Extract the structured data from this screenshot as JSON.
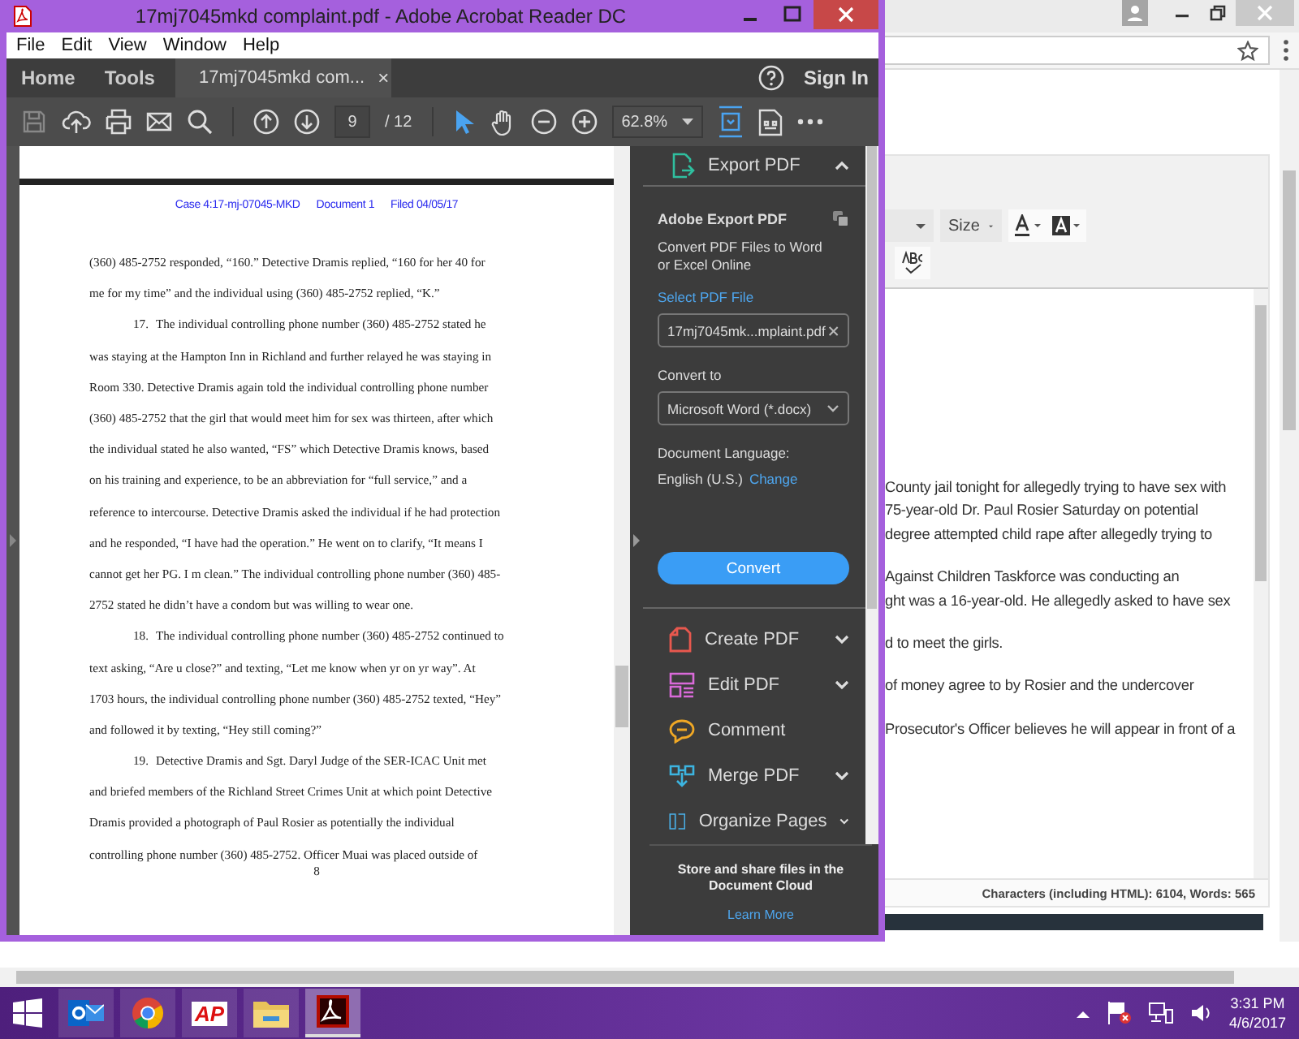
{
  "acrobat": {
    "title": "17mj7045mkd complaint.pdf - Adobe Acrobat Reader DC",
    "menu": [
      "File",
      "Edit",
      "View",
      "Window",
      "Help"
    ],
    "nav": [
      "Home",
      "Tools"
    ],
    "tab": {
      "label": "17mj7045mkd com...",
      "close": "×"
    },
    "sign_in": "Sign In",
    "toolbar": {
      "save_disabled": true,
      "page": "9",
      "page_total": "/ 12",
      "zoom": "62.8%",
      "tools": [
        {
          "kind": "select",
          "selected": true
        },
        {
          "kind": "hand",
          "selected": false
        }
      ]
    },
    "document": {
      "header": [
        "Case 4:17-mj-07045-MKD",
        "Document 1",
        "Filed 04/05/17"
      ],
      "lines": [
        {
          "text": "(360) 485-2752 responded, “160.” Detective Dramis replied, “160 for her 40 for"
        },
        {
          "text": "me for my time” and the individual using (360) 485-2752 replied, “K.”"
        },
        {
          "number": "17.",
          "text": "The individual controlling phone number (360) 485-2752 stated he"
        },
        {
          "text": "was staying at the Hampton Inn in Richland and further relayed he was staying in"
        },
        {
          "text": "Room 330. Detective Dramis again told the individual controlling phone number"
        },
        {
          "text": "(360) 485-2752 that the girl that would meet him for sex was thirteen, after which"
        },
        {
          "text": "the individual stated he also wanted, “FS” which Detective Dramis knows, based"
        },
        {
          "text": "on his training and experience, to be an abbreviation for “full service,” and a"
        },
        {
          "text": "reference to intercourse. Detective Dramis asked the individual if he had protection"
        },
        {
          "text": "and he responded, “I have had the operation.” He went on to clarify, “It means I"
        },
        {
          "text": "cannot get her PG. I m clean.” The individual controlling phone number (360) 485-"
        },
        {
          "text": "2752 stated he didn’t have a condom but was willing to wear one."
        },
        {
          "number": "18.",
          "text": "The individual controlling phone number (360) 485-2752 continued to"
        },
        {
          "text": "text asking, “Are u close?” and texting, “Let me know when yr on yr way”. At"
        },
        {
          "text": "1703 hours, the individual controlling phone number (360) 485-2752 texted, “Hey”"
        },
        {
          "text": "and followed it by texting, “Hey still coming?”"
        },
        {
          "number": "19.",
          "text": "Detective Dramis and Sgt. Daryl Judge of the SER-ICAC Unit met"
        },
        {
          "text": "and briefed members of the Richland Street Crimes Unit at which point Detective"
        },
        {
          "text": "Dramis provided a photograph of Paul Rosier as potentially the individual"
        },
        {
          "text": "controlling phone number (360) 485-2752. Officer Muai was placed outside of"
        }
      ],
      "page_number": "8"
    },
    "panel": {
      "export": {
        "label": "Export PDF",
        "expanded": true
      },
      "heading": "Adobe Export PDF",
      "description": "Convert PDF Files to Word or Excel Online",
      "select_link": "Select PDF File",
      "file": "17mj7045mk...mplaint.pdf",
      "convert_to_label": "Convert to",
      "format": "Microsoft Word (*.docx)",
      "language_label": "Document Language:",
      "language": "English (U.S.)",
      "change_link": "Change",
      "convert_button": "Convert",
      "tools": [
        {
          "kind": "create",
          "label": "Create PDF",
          "expandable": true,
          "color": "#e8584e"
        },
        {
          "kind": "edit",
          "label": "Edit PDF",
          "expandable": true,
          "color": "#d96ad9"
        },
        {
          "kind": "comment",
          "label": "Comment",
          "expandable": false,
          "color": "#f0a825"
        },
        {
          "kind": "merge",
          "label": "Merge PDF",
          "expandable": true,
          "color": "#3cb4e0"
        },
        {
          "kind": "organize",
          "label": "Organize Pages",
          "expandable": true,
          "color": "#4ab0e8"
        }
      ],
      "footer": "Store and share files in the Document Cloud",
      "learn_more": "Learn More"
    }
  },
  "browser": {
    "size_label": "Size",
    "paragraphs": [
      [
        "County jail tonight for allegedly trying to have sex with",
        "75-year-old Dr. Paul Rosier Saturday on potential",
        "degree attempted child rape after allegedly trying to"
      ],
      [
        "Against Children Taskforce was conducting an",
        "ght was a 16-year-old. He allegedly asked to have sex"
      ],
      [
        "d to meet the girls."
      ],
      [
        "of money agree to by Rosier and the undercover"
      ],
      [
        "Prosecutor's Officer believes he will appear in front of a"
      ]
    ],
    "status": "Characters (including HTML): 6104, Words: 565"
  },
  "taskbar": {
    "apps": [
      {
        "kind": "outlook",
        "selected": false
      },
      {
        "kind": "chrome",
        "selected": false
      },
      {
        "kind": "ap",
        "label": "AP",
        "selected": false
      },
      {
        "kind": "explorer",
        "selected": false
      },
      {
        "kind": "acrobat",
        "selected": true
      }
    ],
    "time": "3:31 PM",
    "date": "4/6/2017"
  }
}
